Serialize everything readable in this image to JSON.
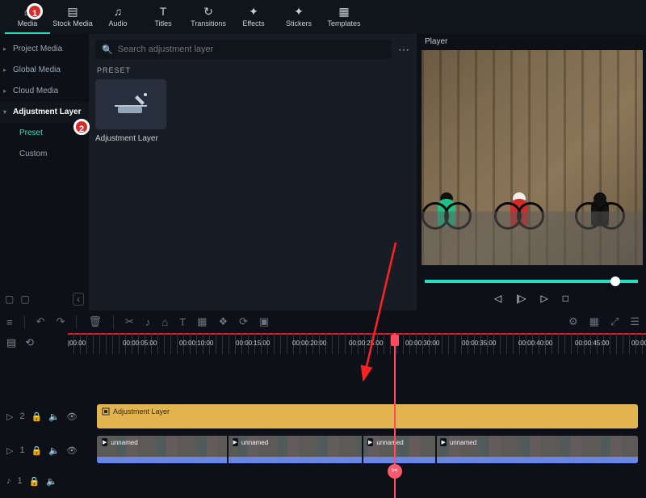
{
  "top_tabs": [
    {
      "label": "Media",
      "icon": "⌂"
    },
    {
      "label": "Stock Media",
      "icon": "▤"
    },
    {
      "label": "Audio",
      "icon": "♫"
    },
    {
      "label": "Titles",
      "icon": "T"
    },
    {
      "label": "Transitions",
      "icon": "↻"
    },
    {
      "label": "Effects",
      "icon": "✦"
    },
    {
      "label": "Stickers",
      "icon": "✦"
    },
    {
      "label": "Templates",
      "icon": "▦"
    }
  ],
  "sidebar": {
    "items": [
      {
        "label": "Project Media"
      },
      {
        "label": "Global Media"
      },
      {
        "label": "Cloud Media"
      },
      {
        "label": "Adjustment Layer",
        "bold": true
      },
      {
        "label": "Preset",
        "active": true,
        "sub": true
      },
      {
        "label": "Custom",
        "sub": true
      }
    ]
  },
  "browser": {
    "search_placeholder": "Search adjustment layer",
    "preset_header": "PRESET",
    "preset_name": "Adjustment Layer"
  },
  "player": {
    "title": "Player",
    "riders": [
      {
        "color": "green"
      },
      {
        "color": "red"
      },
      {
        "color": "black"
      }
    ]
  },
  "timeline": {
    "ticks": [
      "|00:00",
      "00:00:05:00",
      "00:00:10:00",
      "00:00:15:00",
      "00:00:20:00",
      "00:00:25:00",
      "00:00:30:00",
      "00:00:35:00",
      "00:00:40:00",
      "00:00:45:00",
      "00:00:50:00"
    ],
    "adjustment_clip": "Adjustment Layer",
    "video_segments": [
      "unnamed",
      "unnamed",
      "unnamed",
      "unnamed"
    ],
    "playhead_at": "00:00:28:00",
    "track_labels": {
      "t1": "2",
      "t2": "1",
      "t3": "1"
    }
  },
  "annotations": {
    "badge1": "1",
    "badge2": "2"
  },
  "icons": {
    "undo": "↶",
    "redo": "↷",
    "trash": "🗑",
    "cut": "✂",
    "note": "♪",
    "tag": "⌂",
    "text": "T",
    "crop": "▦",
    "adjust": "❖",
    "speed": "⟳",
    "mark": "▣",
    "gear": "⚙",
    "grid": "▦",
    "zoom": "⤢",
    "menu": "☰",
    "prev": "◁",
    "pause": "▷",
    "play": "▷",
    "stop": "□",
    "eye": "👁",
    "lock": "🔒",
    "mute": "🔈",
    "folder": "▢",
    "newfolder": "▢",
    "caret": "‹"
  }
}
